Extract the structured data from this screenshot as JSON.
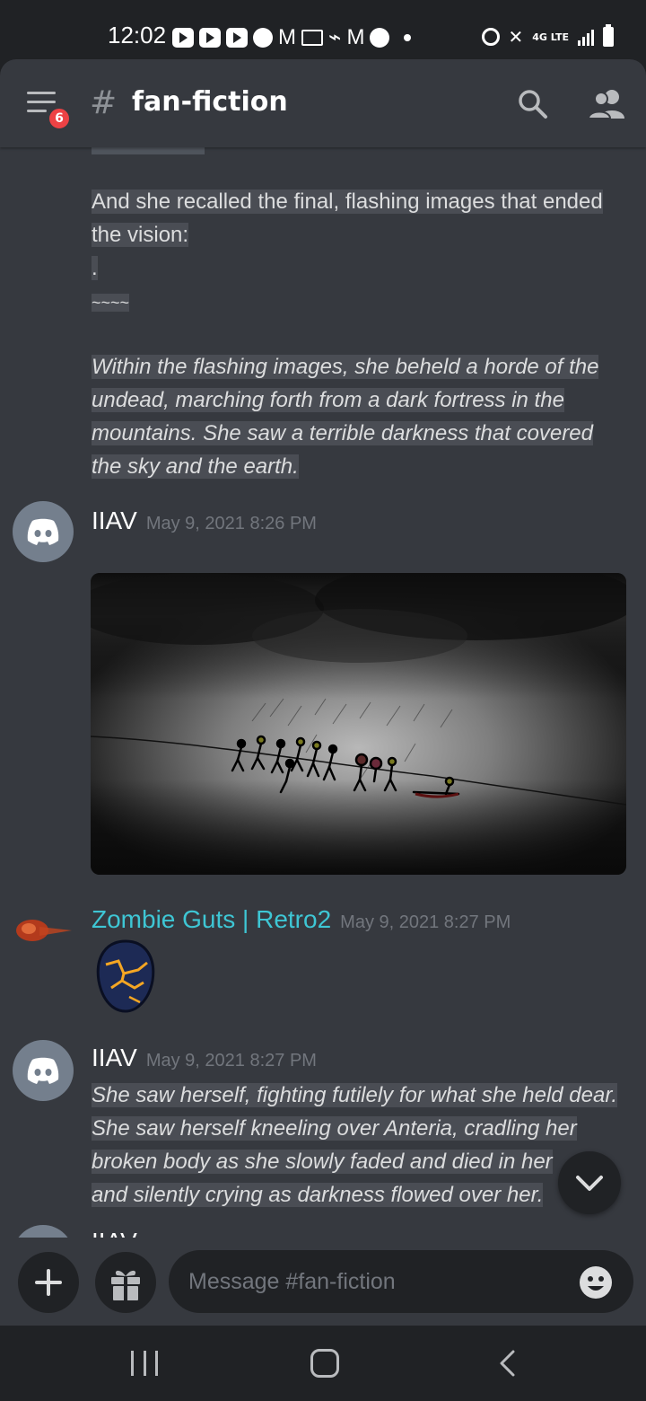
{
  "status_bar": {
    "time": "12:02",
    "network": "4G LTE"
  },
  "header": {
    "notification_count": "6",
    "hash_symbol": "#",
    "channel_name": "fan-fiction"
  },
  "messages": {
    "block1": {
      "line1": "And she recalled the final, flashing images that ended",
      "line2": "the vision:",
      "line3": ".",
      "line4": "~~~~"
    },
    "block2": {
      "line1": "Within the flashing images, she beheld a horde of the",
      "line2": "undead, marching forth from a dark fortress in the",
      "line3": "mountains. She saw a terrible darkness that covered",
      "line4": "the sky and the earth."
    },
    "msg_iiav_1": {
      "author": "IIAV",
      "timestamp": "May 9, 2021 8:26 PM"
    },
    "msg_zombie": {
      "author": "Zombie Guts | Retro2",
      "timestamp": "May 9, 2021 8:27 PM",
      "author_color": "#3ec6d4"
    },
    "msg_iiav_2": {
      "author": "IIAV",
      "timestamp": "May 9, 2021 8:27 PM",
      "line1": "She saw herself, fighting futilely for what she held dear.",
      "line2": "She saw herself kneeling over Anteria, cradling her",
      "line3": "broken body as she slowly faded and died in her",
      "line4": "and silently crying as darkness flowed over her."
    },
    "partial_author": "IIAV"
  },
  "composer": {
    "placeholder": "Message #fan-fiction"
  },
  "colors": {
    "background": "#36393f",
    "dark": "#202225",
    "highlight": "#4a4d54",
    "badge": "#ed4245"
  },
  "icons": {
    "menu": "hamburger-icon",
    "search": "search-icon",
    "members": "members-icon",
    "discord_avatar": "discord-logo-icon",
    "scroll": "chevron-down-icon",
    "plus": "plus-icon",
    "gift": "gift-icon",
    "emoji": "emoji-icon"
  }
}
